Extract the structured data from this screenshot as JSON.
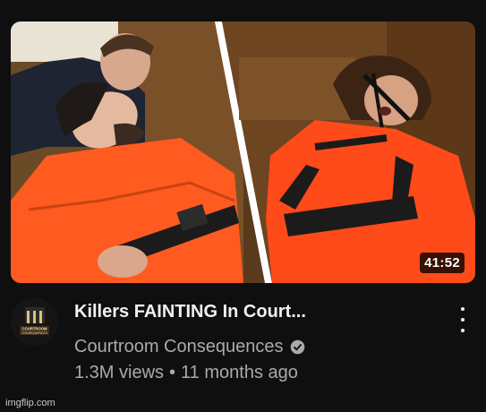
{
  "video": {
    "duration": "41:52",
    "title": "Killers FAINTING In Court...",
    "channel": "Courtroom Consequences",
    "views": "1.3M views",
    "separator": "•",
    "age": "11 months ago"
  },
  "avatar": {
    "line1": "COURTROOM",
    "line2": "CONSEQUENCES"
  },
  "watermark": "imgflip.com",
  "icons": {
    "verified": "verified-check-icon",
    "menu": "more-vert-icon"
  },
  "colors": {
    "background": "#0f0f0f",
    "title": "#f1f1f1",
    "secondary": "#aaaaaa",
    "jumpsuit": "#ff5a1f"
  }
}
